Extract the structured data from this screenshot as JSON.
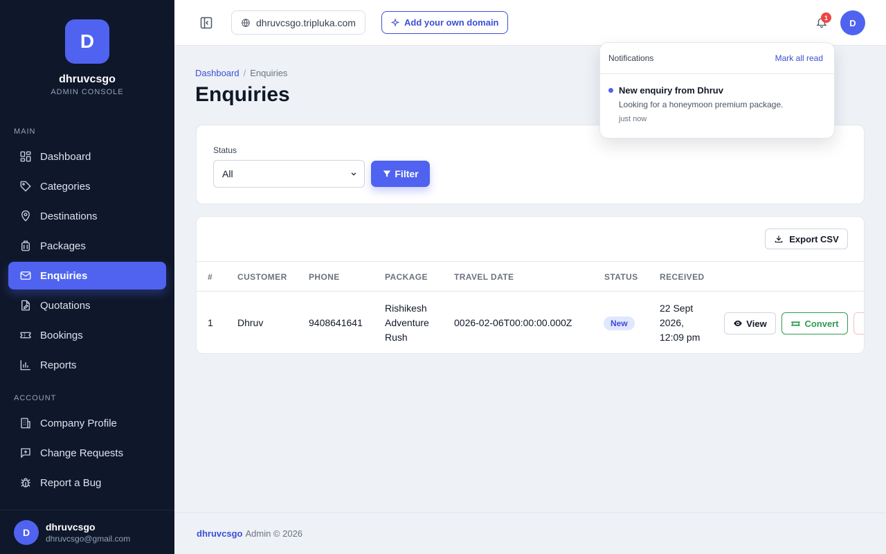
{
  "brand": {
    "initial": "D",
    "name": "dhruvcsgo",
    "subtitle": "ADMIN CONSOLE"
  },
  "sidebar": {
    "main_label": "MAIN",
    "main_items": [
      {
        "label": "Dashboard",
        "icon": "dashboard-icon"
      },
      {
        "label": "Categories",
        "icon": "tag-icon"
      },
      {
        "label": "Destinations",
        "icon": "map-pin-icon"
      },
      {
        "label": "Packages",
        "icon": "luggage-icon"
      },
      {
        "label": "Enquiries",
        "icon": "mail-icon",
        "active": true
      },
      {
        "label": "Quotations",
        "icon": "edit-document-icon"
      },
      {
        "label": "Bookings",
        "icon": "ticket-icon"
      },
      {
        "label": "Reports",
        "icon": "bar-chart-icon"
      }
    ],
    "account_label": "ACCOUNT",
    "account_items": [
      {
        "label": "Company Profile",
        "icon": "building-icon"
      },
      {
        "label": "Change Requests",
        "icon": "message-plus-icon"
      },
      {
        "label": "Report a Bug",
        "icon": "bug-icon"
      }
    ],
    "user": {
      "initial": "D",
      "name": "dhruvcsgo",
      "email": "dhruvcsgo@gmail.com"
    }
  },
  "topbar": {
    "domain": "dhruvcsgo.tripluka.com",
    "add_domain_label": "Add your own domain",
    "notification_count": "1",
    "avatar_initial": "D"
  },
  "breadcrumb": {
    "root": "Dashboard",
    "separator": "/",
    "current": "Enquiries"
  },
  "page_title": "Enquiries",
  "filter": {
    "status_label": "Status",
    "status_value": "All",
    "filter_label": "Filter"
  },
  "table": {
    "export_label": "Export CSV",
    "columns": [
      "#",
      "CUSTOMER",
      "PHONE",
      "PACKAGE",
      "TRAVEL DATE",
      "STATUS",
      "RECEIVED"
    ],
    "rows": [
      {
        "index": "1",
        "customer": "Dhruv",
        "phone": "9408641641",
        "package_lines": [
          "Rishikesh",
          "Adventure",
          "Rush"
        ],
        "travel_date": "0026-02-06T00:00:00.000Z",
        "status": "New",
        "received_lines": [
          "22 Sept",
          "2026,",
          "12:09 pm"
        ],
        "view_label": "View",
        "convert_label": "Convert"
      }
    ]
  },
  "footer": {
    "brand": "dhruvcsgo",
    "text": "Admin © 2026"
  },
  "notifications": {
    "title": "Notifications",
    "mark_all": "Mark all read",
    "items": [
      {
        "title": "New enquiry from Dhruv",
        "body": "Looking for a honeymoon premium package.",
        "time": "just now"
      }
    ]
  },
  "colors": {
    "sidebar_bg": "#0f172a",
    "accent": "#4f63f0",
    "success": "#2e9b50",
    "danger": "#ef4444",
    "page_bg": "#eef1f6"
  }
}
